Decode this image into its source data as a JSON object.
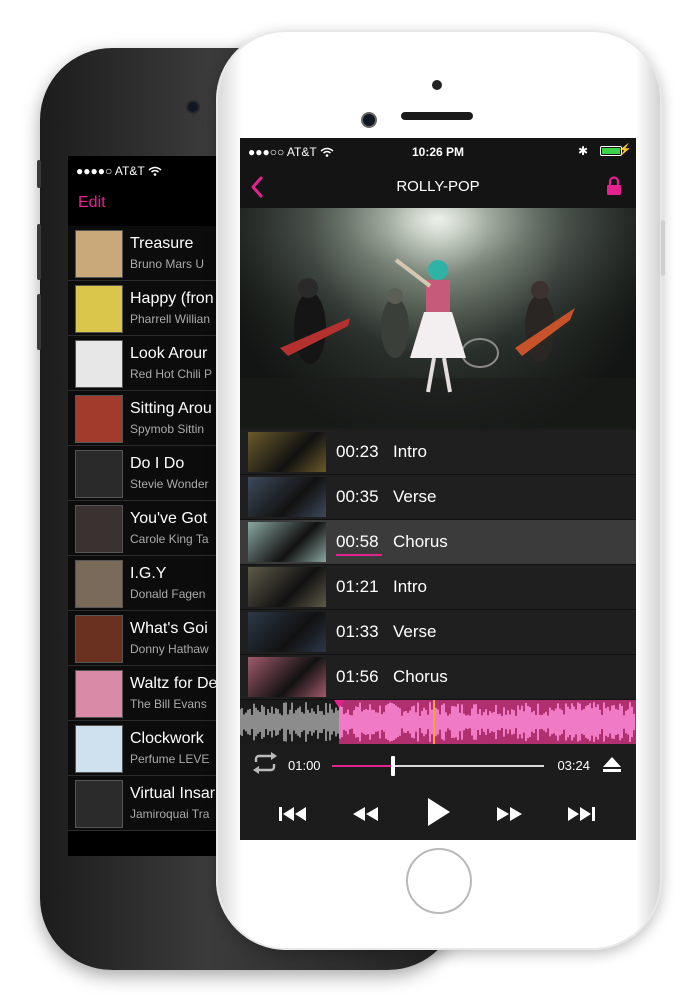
{
  "back_phone": {
    "status": {
      "carrier": "●●●●○ AT&T"
    },
    "edit_label": "Edit",
    "songs": [
      {
        "title": "Treasure",
        "artist": "Bruno Mars   U",
        "art_color": "#c9a979"
      },
      {
        "title": "Happy (fron",
        "artist": "Pharrell Willian",
        "art_color": "#d9c64a"
      },
      {
        "title": "Look Arour",
        "artist": "Red Hot Chili P",
        "art_color": "#e7e7e7"
      },
      {
        "title": "Sitting Arou",
        "artist": "Spymob   Sittin",
        "art_color": "#a33b2c"
      },
      {
        "title": "Do I Do",
        "artist": "Stevie Wonder",
        "art_color": "#2a2a2a"
      },
      {
        "title": "You've Got",
        "artist": "Carole King   Ta",
        "art_color": "#3a3230"
      },
      {
        "title": "I.G.Y",
        "artist": "Donald Fagen",
        "art_color": "#7a6a5a"
      },
      {
        "title": "What's Goi",
        "artist": "Donny Hathaw",
        "art_color": "#6a3020"
      },
      {
        "title": "Waltz for De",
        "artist": "The Bill Evans",
        "art_color": "#d98aa6"
      },
      {
        "title": "Clockwork",
        "artist": "Perfume   LEVE",
        "art_color": "#cfe0ee"
      },
      {
        "title": "Virtual Insar",
        "artist": "Jamiroquai   Tra",
        "art_color": "#2b2b2b"
      }
    ]
  },
  "front_phone": {
    "status": {
      "carrier": "●●●○○ AT&T",
      "time": "10:26 PM",
      "bluetooth": "✱",
      "battery_bolt": "⚡"
    },
    "nav": {
      "back": "‹",
      "title": "ROLLY-POP"
    },
    "sections": [
      {
        "time": "00:23",
        "label": "Intro",
        "thumb_color": "#6b5a2a"
      },
      {
        "time": "00:35",
        "label": "Verse",
        "thumb_color": "#3d4a5c"
      },
      {
        "time": "00:58",
        "label": "Chorus",
        "thumb_color": "#8aa7a0",
        "active": true
      },
      {
        "time": "01:21",
        "label": "Intro",
        "thumb_color": "#5e5a48"
      },
      {
        "time": "01:33",
        "label": "Verse",
        "thumb_color": "#2c3848"
      },
      {
        "time": "01:56",
        "label": "Chorus",
        "thumb_color": "#a25a6a"
      }
    ],
    "player": {
      "current_time": "01:00",
      "total_time": "03:24",
      "progress": 0.29
    },
    "waveform": {
      "played_fraction": 0.25,
      "loop_start_fraction": 0.25,
      "marker_fraction": 0.49
    },
    "colors": {
      "accent": "#e4228f",
      "waveform_pink": "#f07ac6",
      "marker": "#f2a23a"
    }
  }
}
